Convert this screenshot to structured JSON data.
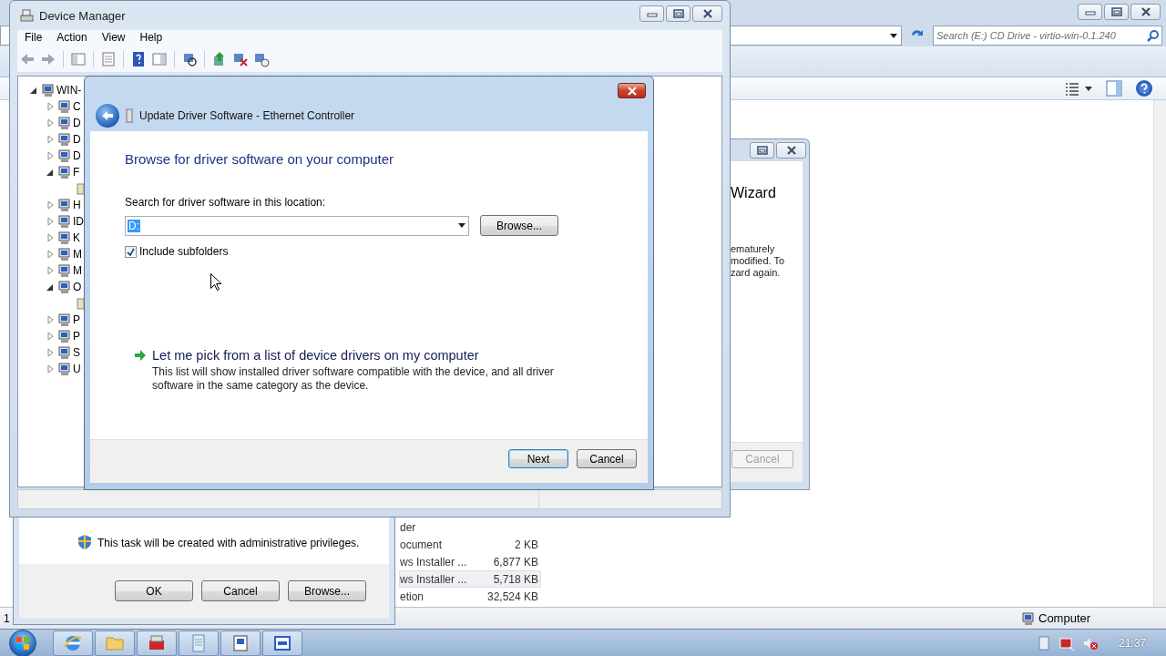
{
  "explorer": {
    "search_placeholder": "Search (E:) CD Drive - virtio-win-0.1.240",
    "files": [
      {
        "type": "der",
        "selected": false
      },
      {
        "type": "ocument",
        "size": "2 KB",
        "selected": false
      },
      {
        "type": "ws Installer ...",
        "size": "6,877 KB",
        "selected": false
      },
      {
        "type": "ws Installer ...",
        "size": "5,718 KB",
        "selected": true
      },
      {
        "type": "etion",
        "size": "32,524 KB",
        "selected": false
      }
    ],
    "status_item": "Computer",
    "edge_text": "1"
  },
  "wizard": {
    "title": "Wizard",
    "text_lines": [
      "ematurely",
      "modified. To",
      "zard again."
    ],
    "button": {
      "label": "Cancel",
      "disabled": true
    }
  },
  "task_dialog": {
    "message": "This task will be created with administrative privileges.",
    "buttons": [
      "OK",
      "Cancel",
      "Browse..."
    ]
  },
  "device_manager": {
    "title": "Device Manager",
    "menu": [
      "File",
      "Action",
      "View",
      "Help"
    ],
    "tree": [
      {
        "kind": "group",
        "label": "WIN-",
        "expanded": true,
        "children": [
          {
            "kind": "group",
            "label": "C",
            "expanded": false
          },
          {
            "kind": "group",
            "label": "D",
            "expanded": false
          },
          {
            "kind": "group",
            "label": "D",
            "expanded": false
          },
          {
            "kind": "group",
            "label": "D",
            "expanded": false
          },
          {
            "kind": "group",
            "label": "F",
            "expanded": true,
            "children": [
              {
                "kind": "leaf"
              }
            ]
          },
          {
            "kind": "group",
            "label": "H",
            "expanded": false
          },
          {
            "kind": "group",
            "label": "ID",
            "expanded": false
          },
          {
            "kind": "group",
            "label": "K",
            "expanded": false
          },
          {
            "kind": "group",
            "label": "M",
            "expanded": false
          },
          {
            "kind": "group",
            "label": "M",
            "expanded": false
          },
          {
            "kind": "group",
            "label": "O",
            "expanded": true,
            "children": [
              {
                "kind": "leaf"
              }
            ]
          },
          {
            "kind": "group",
            "label": "P",
            "expanded": false
          },
          {
            "kind": "group",
            "label": "P",
            "expanded": false
          },
          {
            "kind": "group",
            "label": "S",
            "expanded": false
          },
          {
            "kind": "group",
            "label": "U",
            "expanded": false
          }
        ]
      }
    ]
  },
  "update_driver": {
    "title": "Update Driver Software - Ethernet Controller",
    "heading": "Browse for driver software on your computer",
    "location_label": "Search for driver software in this location:",
    "location_value": "D:",
    "browse_button": "Browse...",
    "include_subfolders": {
      "label": "Include subfolders",
      "checked": true
    },
    "pick_link": "Let me pick from a list of device drivers on my computer",
    "pick_description": "This list will show installed driver software compatible with the device, and all driver software in the same category as the device.",
    "buttons": [
      {
        "label": "Next",
        "default": true
      },
      {
        "label": "Cancel",
        "default": false
      }
    ]
  },
  "taskbar": {
    "clock": "21:37"
  }
}
